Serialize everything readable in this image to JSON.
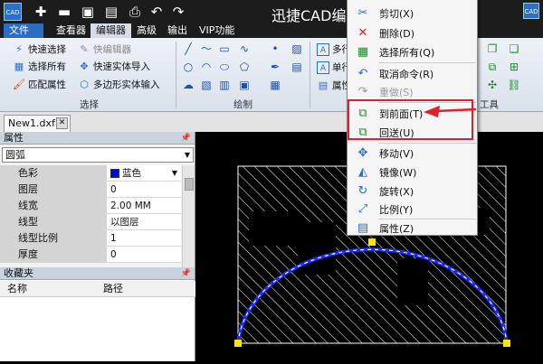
{
  "app": {
    "title": "迅捷CAD编",
    "logo": "CAD"
  },
  "menu": {
    "tabs": [
      "文件",
      "查看器",
      "编辑器",
      "高级",
      "输出",
      "VIP功能"
    ],
    "active": "编辑器"
  },
  "ribbon": {
    "select_group": {
      "label": "选择",
      "items": [
        "快速选择",
        "快编辑器",
        "选择所有",
        "快速实体导入",
        "匹配属性",
        "多边形实体输入"
      ]
    },
    "draw_group": {
      "label": "绘制"
    },
    "text_group": {
      "items": [
        "多行",
        "单行",
        "属性"
      ]
    },
    "tools_group": {
      "label": "工具"
    }
  },
  "document": {
    "tab": "New1.dxf",
    "close": "✕"
  },
  "properties": {
    "title": "属性",
    "entity": "圆弧",
    "rows": [
      {
        "name": "色彩",
        "value": "蓝色"
      },
      {
        "name": "图层",
        "value": "0"
      },
      {
        "name": "线宽",
        "value": "2.00 MM"
      },
      {
        "name": "线型",
        "value": "以图层"
      },
      {
        "name": "线型比例",
        "value": "1"
      },
      {
        "name": "厚度",
        "value": "0"
      }
    ]
  },
  "favorites": {
    "title": "收藏夹",
    "col_name": "名称",
    "col_path": "路径"
  },
  "context_menu": {
    "items": [
      {
        "label": "剪切(X)",
        "icon": "scissors-icon",
        "enabled": true
      },
      {
        "label": "删除(D)",
        "icon": "delete-icon",
        "enabled": true
      },
      {
        "label": "选择所有(Q)",
        "icon": "select-all-icon",
        "enabled": true
      },
      {
        "label": "取消命令(R)",
        "icon": "undo-icon",
        "enabled": true
      },
      {
        "label": "重做(S)",
        "icon": "redo-icon",
        "enabled": false
      },
      {
        "label": "到前面(T)",
        "icon": "bring-front-icon",
        "enabled": true
      },
      {
        "label": "回送(U)",
        "icon": "send-back-icon",
        "enabled": true
      },
      {
        "label": "移动(V)",
        "icon": "move-icon",
        "enabled": true
      },
      {
        "label": "镜像(W)",
        "icon": "mirror-icon",
        "enabled": true
      },
      {
        "label": "旋转(X)",
        "icon": "rotate-icon",
        "enabled": true
      },
      {
        "label": "比例(Y)",
        "icon": "scale-icon",
        "enabled": true
      },
      {
        "label": "属性(Z)",
        "icon": "properties-icon",
        "enabled": true
      }
    ]
  },
  "colors": {
    "accent": "#2b6cc4",
    "highlight": "#e0202a",
    "arc": "#1a2cff",
    "grip": "#ffe600"
  }
}
